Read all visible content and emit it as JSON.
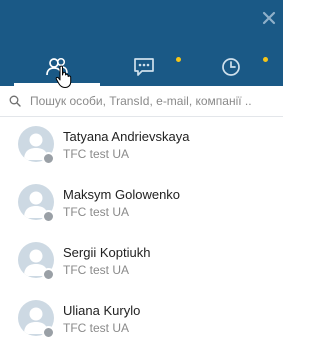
{
  "colors": {
    "header": "#1a5986",
    "notification": "#f5c518",
    "status_offline": "#9aa0a6"
  },
  "tabs": [
    {
      "id": "contacts",
      "icon": "contacts-icon",
      "active": true
    },
    {
      "id": "chats",
      "icon": "chat-icon",
      "active": false,
      "has_notification": true
    },
    {
      "id": "history",
      "icon": "clock-icon",
      "active": false,
      "has_notification": true
    }
  ],
  "search": {
    "placeholder": "Пошук особи, TransId, e-mail, компанії .."
  },
  "contacts": [
    {
      "name": "Tatyana Andrievskaya",
      "company": "TFC test UA",
      "status": "offline"
    },
    {
      "name": "Maksym Golowenko",
      "company": "TFC test UA",
      "status": "offline"
    },
    {
      "name": "Sergii Koptiukh",
      "company": "TFC test UA",
      "status": "offline"
    },
    {
      "name": "Uliana Kurylo",
      "company": "TFC test UA",
      "status": "offline"
    }
  ]
}
